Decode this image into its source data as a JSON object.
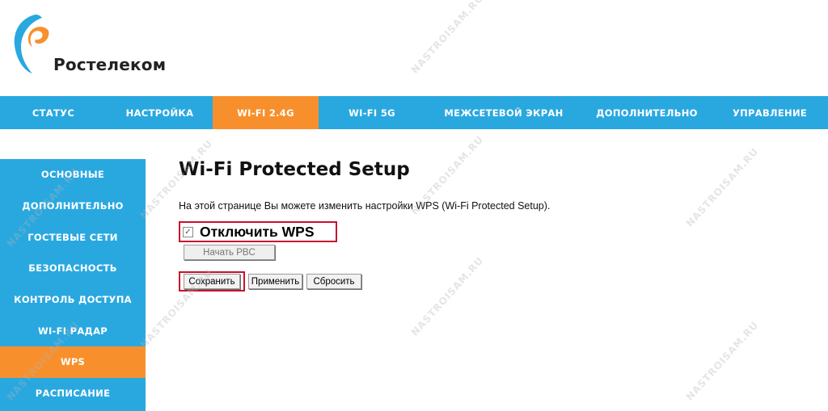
{
  "brand": {
    "name": "Ростелеком",
    "colors": {
      "blue": "#29a8e0",
      "orange": "#f7902c",
      "highlight": "#c8102e"
    }
  },
  "top_nav": {
    "tabs": [
      {
        "label": "СТАТУС",
        "active": false
      },
      {
        "label": "НАСТРОЙКА",
        "active": false
      },
      {
        "label": "WI-FI 2.4G",
        "active": true
      },
      {
        "label": "WI-FI 5G",
        "active": false
      },
      {
        "label": "МЕЖСЕТЕВОЙ ЭКРАН",
        "active": false
      },
      {
        "label": "ДОПОЛНИТЕЛЬНО",
        "active": false
      },
      {
        "label": "УПРАВЛЕНИЕ",
        "active": false
      }
    ]
  },
  "sidebar": {
    "items": [
      {
        "label": "ОСНОВНЫЕ",
        "active": false
      },
      {
        "label": "ДОПОЛНИТЕЛЬНО",
        "active": false
      },
      {
        "label": "ГОСТЕВЫЕ СЕТИ",
        "active": false
      },
      {
        "label": "БЕЗОПАСНОСТЬ",
        "active": false
      },
      {
        "label": "КОНТРОЛЬ ДОСТУПА",
        "active": false
      },
      {
        "label": "WI-FI РАДАР",
        "active": false
      },
      {
        "label": "WPS",
        "active": true
      },
      {
        "label": "РАСПИСАНИЕ",
        "active": false
      }
    ]
  },
  "main": {
    "title": "Wi-Fi Protected Setup",
    "description": "На этой странице Вы можете изменить настройки WPS (Wi-Fi Protected Setup).",
    "disable_wps": {
      "label": "Отключить WPS",
      "checked": true
    },
    "start_pbc_label": "Начать PBC",
    "save_label": "Сохранить",
    "apply_label": "Применить",
    "reset_label": "Сбросить"
  },
  "watermark": "NASTROISAM.RU",
  "icons": {
    "logo": "rostelecom-logo-icon",
    "checkbox": "checkmark-icon"
  }
}
